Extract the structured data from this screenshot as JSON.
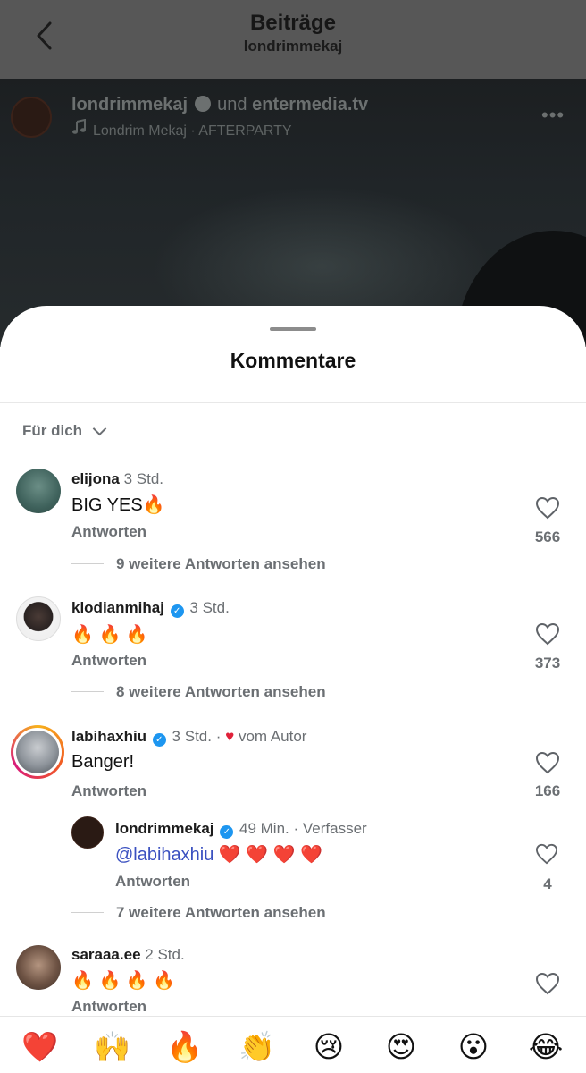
{
  "header": {
    "title": "Beiträge",
    "subtitle": "londrimmekaj"
  },
  "post": {
    "user": "londrimmekaj",
    "and_word": "und",
    "collab": "entermedia.tv",
    "music": "Londrim Mekaj · AFTERPARTY"
  },
  "sheet": {
    "title": "Kommentare",
    "sort_label": "Für dich"
  },
  "comments": [
    {
      "user": "elijona",
      "time": "3 Std.",
      "text": "BIG YES🔥",
      "reply": "Antworten",
      "likes": "566",
      "more_replies": "9 weitere Antworten ansehen"
    },
    {
      "user": "klodianmihaj",
      "time": "3 Std.",
      "text": "🔥 🔥 🔥",
      "reply": "Antworten",
      "likes": "373",
      "more_replies": "8 weitere Antworten ansehen"
    },
    {
      "user": "labihaxhiu",
      "time": "3 Std.",
      "meta": "vom Autor",
      "text": "Banger!",
      "reply": "Antworten",
      "likes": "166",
      "more_replies": "7 weitere Antworten ansehen",
      "sub_reply": {
        "user": "londrimmekaj",
        "time": "49 Min.",
        "meta": "Verfasser",
        "mention": "@labihaxhiu",
        "text": " ❤️ ❤️ ❤️ ❤️",
        "reply": "Antworten",
        "likes": "4"
      }
    },
    {
      "user": "saraaa.ee",
      "time": "2 Std.",
      "text": "🔥 🔥 🔥 🔥",
      "reply": "Antworten"
    }
  ],
  "emoji_bar": [
    "❤️",
    "🙌",
    "🔥",
    "👏",
    "😢",
    "😍",
    "😮",
    "😂"
  ],
  "colors": {
    "accent_verify": "#1d96f0",
    "mention": "#3a50c0",
    "heart": "#e0213a",
    "nav_bg": "#575757"
  }
}
